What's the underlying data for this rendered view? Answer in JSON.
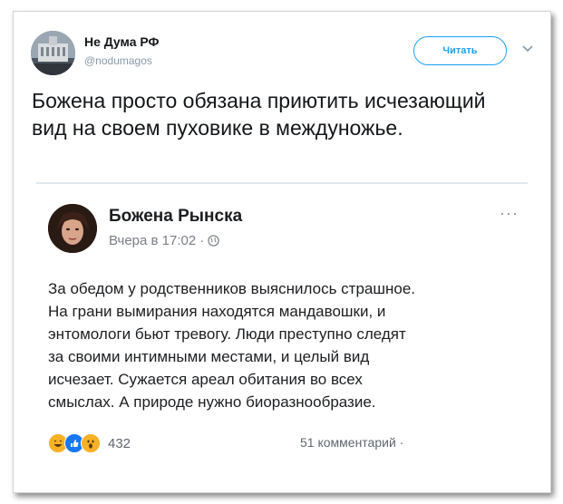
{
  "tweet": {
    "display_name": "Не Дума РФ",
    "handle": "@nodumagos",
    "follow_label": "Читать",
    "text": "Божена просто обязана приютить исчезающий вид на своем пуховике в междуножье."
  },
  "embedded_post": {
    "author": "Божена Рынска",
    "meta": "Вчера в 17:02 ·",
    "more": "···",
    "text": "За обедом у родственников выяснилось страшное.\nНа грани вымирания находятся мандавошки, и\nэнтомологи бьют тревогу. Люди преступно следят\nза своими интимными местами, и целый вид\nисчезает. Сужается ареал обитания во всех\nсмыслах. А природе нужно биоразнообразие.",
    "reactions_count": "432",
    "comments": "51 комментарий ·",
    "reaction_icons": [
      "haha-icon",
      "like-icon",
      "wow-icon"
    ]
  },
  "colors": {
    "twitter_blue": "#1da1f2",
    "fb_like": "#1877f2",
    "fb_emoji": "#f7b125"
  }
}
